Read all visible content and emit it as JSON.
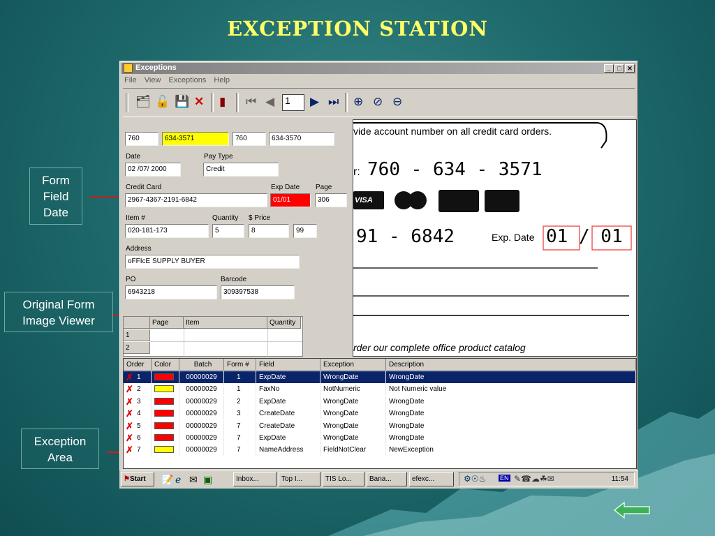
{
  "slide": {
    "title": "EXCEPTION STATION"
  },
  "callouts": {
    "form_field": [
      "Form",
      "Field",
      "Date"
    ],
    "viewer": [
      "Original Form",
      "Image Viewer"
    ],
    "exception": [
      "Exception",
      "Area"
    ]
  },
  "window": {
    "title": "Exceptions",
    "min": "_",
    "max": "□",
    "close": "✕",
    "menu": [
      "File",
      "View",
      "Exceptions",
      "Help"
    ],
    "toolbar": {
      "page_value": "1"
    }
  },
  "form": {
    "phone": [
      "760",
      "634-3571",
      "760",
      "634-3570"
    ],
    "date_label": "Date",
    "date_value": "02 /07/ 2000",
    "paytype_label": "Pay Type",
    "paytype_value": "Credit",
    "cc_label": "Credit Card",
    "cc_value": "2967-4367-2191-6842",
    "exp_label": "Exp Date",
    "exp_value": "01/01",
    "page_label": "Page",
    "page_value": "306",
    "item_label": "Item #",
    "item_value": "020-181-173",
    "qty_label": "Quantity",
    "qty_value": "5",
    "price_label": "$ Price",
    "price_value": "8",
    "price_cents": "99",
    "address_label": "Address",
    "address_value": "oFFIcE SUPPLY BUYER",
    "po_label": "PO",
    "po_value": "6943218",
    "barcode_label": "Barcode",
    "barcode_value": "309397538",
    "grid_headers": [
      "Page",
      "Item",
      "Quantity"
    ],
    "grid_rows": [
      "1",
      "2"
    ]
  },
  "viewer": {
    "line1": "vide account number on all credit card orders.",
    "phone_digits": [
      "7",
      "6",
      "0",
      "6",
      "3",
      "4",
      "3",
      "5",
      "7",
      "1"
    ],
    "prefix": "r:",
    "visa": "VISA",
    "cc_digits": [
      "9",
      "1",
      "6",
      "8",
      "4",
      "2"
    ],
    "exp_label": "Exp. Date",
    "exp_digits": [
      "0",
      "1",
      "0",
      "1"
    ],
    "bottom_text": "rder our complete office product catalog"
  },
  "exceptions": {
    "headers": [
      "Order",
      "Color",
      "Batch",
      "Form #",
      "Field",
      "Exception",
      "Description"
    ],
    "rows": [
      {
        "order": "1",
        "color": "#ff0000",
        "batch": "00000029",
        "form": "1",
        "field": "ExpDate",
        "exception": "WrongDate",
        "description": "WrongDate"
      },
      {
        "order": "2",
        "color": "#ffff00",
        "batch": "00000029",
        "form": "1",
        "field": "FaxNo",
        "exception": "NotNumeric",
        "description": "Not Numeric value"
      },
      {
        "order": "3",
        "color": "#ff0000",
        "batch": "00000029",
        "form": "2",
        "field": "ExpDate",
        "exception": "WrongDate",
        "description": "WrongDate"
      },
      {
        "order": "4",
        "color": "#ff0000",
        "batch": "00000029",
        "form": "3",
        "field": "CreateDate",
        "exception": "WrongDate",
        "description": "WrongDate"
      },
      {
        "order": "5",
        "color": "#ff0000",
        "batch": "00000029",
        "form": "7",
        "field": "CreateDate",
        "exception": "WrongDate",
        "description": "WrongDate"
      },
      {
        "order": "6",
        "color": "#ff0000",
        "batch": "00000029",
        "form": "7",
        "field": "ExpDate",
        "exception": "WrongDate",
        "description": "WrongDate"
      },
      {
        "order": "7",
        "color": "#ffff00",
        "batch": "00000029",
        "form": "7",
        "field": "NameAddress",
        "exception": "FieldNotClear",
        "description": "NewException"
      }
    ]
  },
  "taskbar": {
    "start": "Start",
    "tasks": [
      "Inbox...",
      "Top I...",
      "TIS Lo...",
      "Bana...",
      "efexc..."
    ],
    "tray_lang": "EN",
    "clock": "11:54"
  },
  "colors": {
    "highlight_yellow": "#ffff00",
    "error_red": "#ff0000",
    "selection": "#0a246a"
  }
}
